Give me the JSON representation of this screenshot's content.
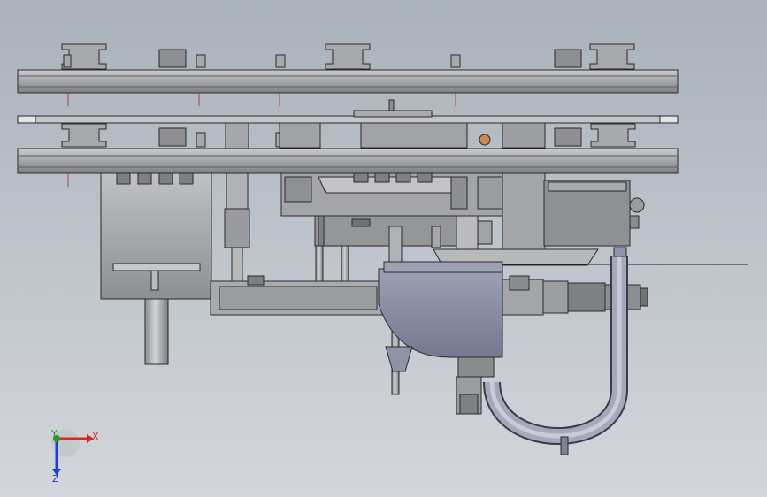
{
  "viewport": {
    "background_top": "#a9b1ba",
    "background_bottom": "#d3d7dc",
    "part_fill": "#9a9ca0",
    "part_fill_light": "#b3b5b8",
    "part_fill_dark": "#7e8084",
    "edge_color": "#2a2a2a",
    "blue_part_fill": "#8f93a8",
    "blue_part_dark": "#6f7388"
  },
  "triad": {
    "x_label": "X",
    "y_label": "Y",
    "z_label": "Z",
    "x_color": "#e0241c",
    "y_color": "#1f9a2a",
    "z_color": "#1c3fd6"
  }
}
